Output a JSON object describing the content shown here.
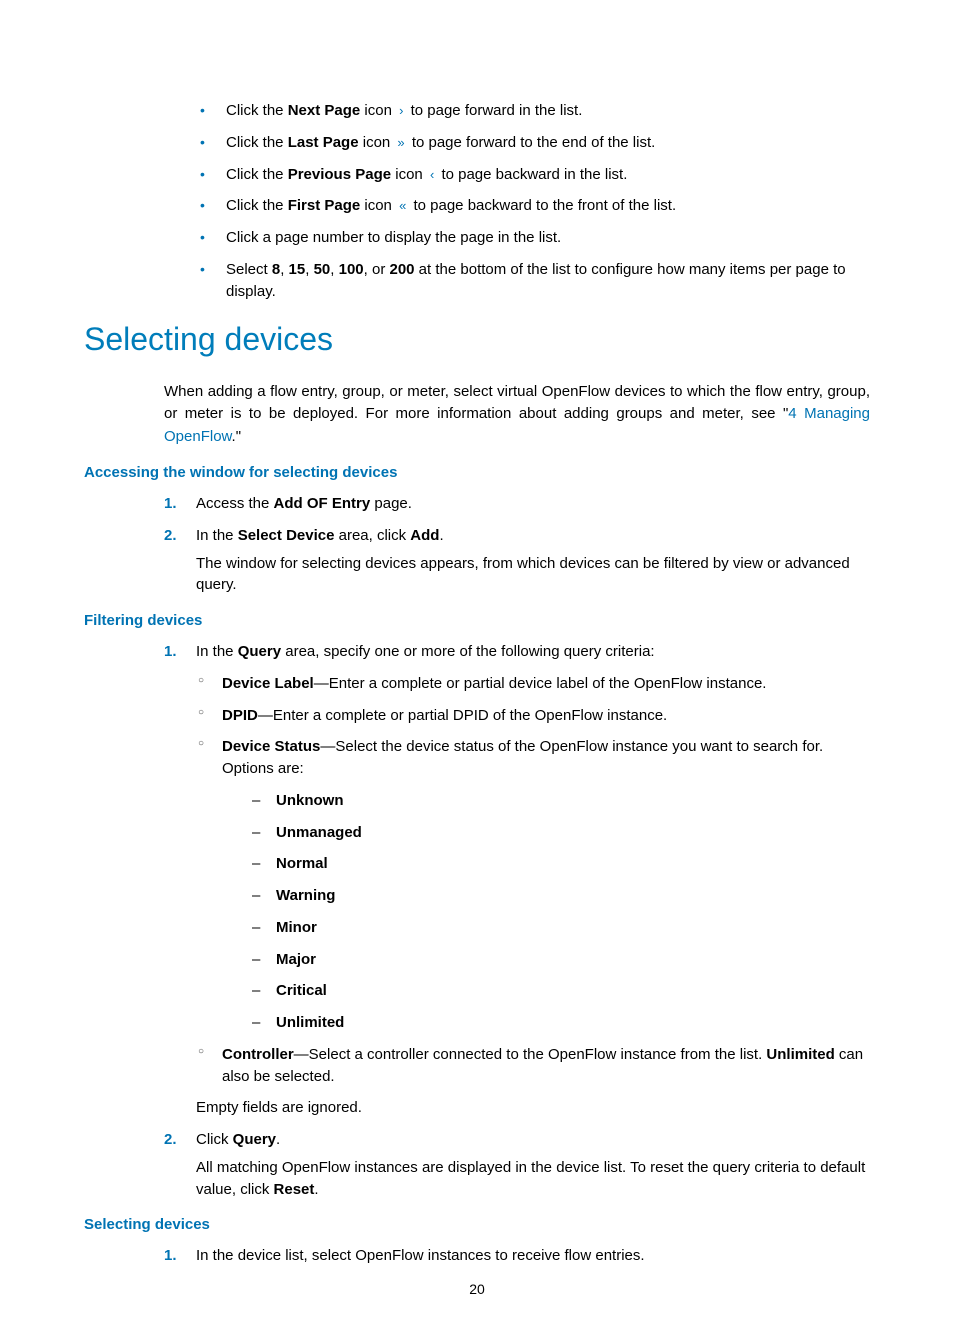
{
  "bullets": {
    "next_pre": "Click the ",
    "next_b": "Next Page",
    "next_post": " icon ",
    "next_tail": " to page forward in the list.",
    "last_pre": "Click the ",
    "last_b": "Last Page",
    "last_post": " icon ",
    "last_tail": " to page forward to the end of the list.",
    "prev_pre": "Click the ",
    "prev_b": "Previous Page",
    "prev_post": " icon ",
    "prev_tail": " to page backward in the list.",
    "first_pre": "Click the ",
    "first_b": "First Page",
    "first_post": " icon ",
    "first_tail": " to page backward to the front of the list.",
    "pagenum": "Click a page number to display the page in the list.",
    "select_pre": "Select ",
    "n8": "8",
    "c1": ", ",
    "n15": "15",
    "c2": ", ",
    "n50": "50",
    "c3": ", ",
    "n100": "100",
    "c4": ", or ",
    "n200": "200",
    "select_post": " at the bottom of the list to configure how many items per page to display."
  },
  "heading_selecting_devices": "Selecting devices",
  "intro_pre": "When adding a flow entry, group, or meter, select virtual OpenFlow devices to which the flow entry, group, or meter is to be deployed. For more information about adding groups and meter, see \"",
  "intro_link_num": "4",
  "intro_link_text": "Managing OpenFlow",
  "intro_post": ".\"",
  "h3_accessing": "Accessing the window for selecting devices",
  "access": {
    "s1_pre": "Access the ",
    "s1_b": "Add OF Entry",
    "s1_post": " page.",
    "s2_pre": "In the ",
    "s2_b1": "Select Device",
    "s2_mid": " area, click ",
    "s2_b2": "Add",
    "s2_post": ".",
    "s2_follow": "The window for selecting devices appears, from which devices can be filtered by view or advanced query."
  },
  "h3_filtering": "Filtering devices",
  "filter": {
    "s1_pre": "In the ",
    "s1_b": "Query",
    "s1_post": " area, specify one or more of the following query criteria:",
    "dl_b": "Device Label",
    "dl_t": "—Enter a complete or partial device label of the OpenFlow instance.",
    "dp_b": "DPID",
    "dp_t": "—Enter a complete or partial DPID of the OpenFlow instance.",
    "ds_b": "Device Status",
    "ds_t": "—Select the device status of the OpenFlow instance you want to search for. Options are:",
    "opts": [
      "Unknown",
      "Unmanaged",
      "Normal",
      "Warning",
      "Minor",
      "Major",
      "Critical",
      "Unlimited"
    ],
    "ctl_b": "Controller",
    "ctl_t1": "—Select a controller connected to the OpenFlow instance from the list. ",
    "ctl_b2": "Unlimited",
    "ctl_t2": " can also be selected.",
    "empty": "Empty fields are ignored.",
    "s2_pre": "Click ",
    "s2_b": "Query",
    "s2_post": ".",
    "s2_follow_pre": "All matching OpenFlow instances are displayed in the device list. To reset the query criteria to default value, click ",
    "s2_follow_b": "Reset",
    "s2_follow_post": "."
  },
  "h3_selecting": "Selecting devices",
  "select_step1": "In the device list, select OpenFlow instances to receive flow entries.",
  "page_number": "20"
}
